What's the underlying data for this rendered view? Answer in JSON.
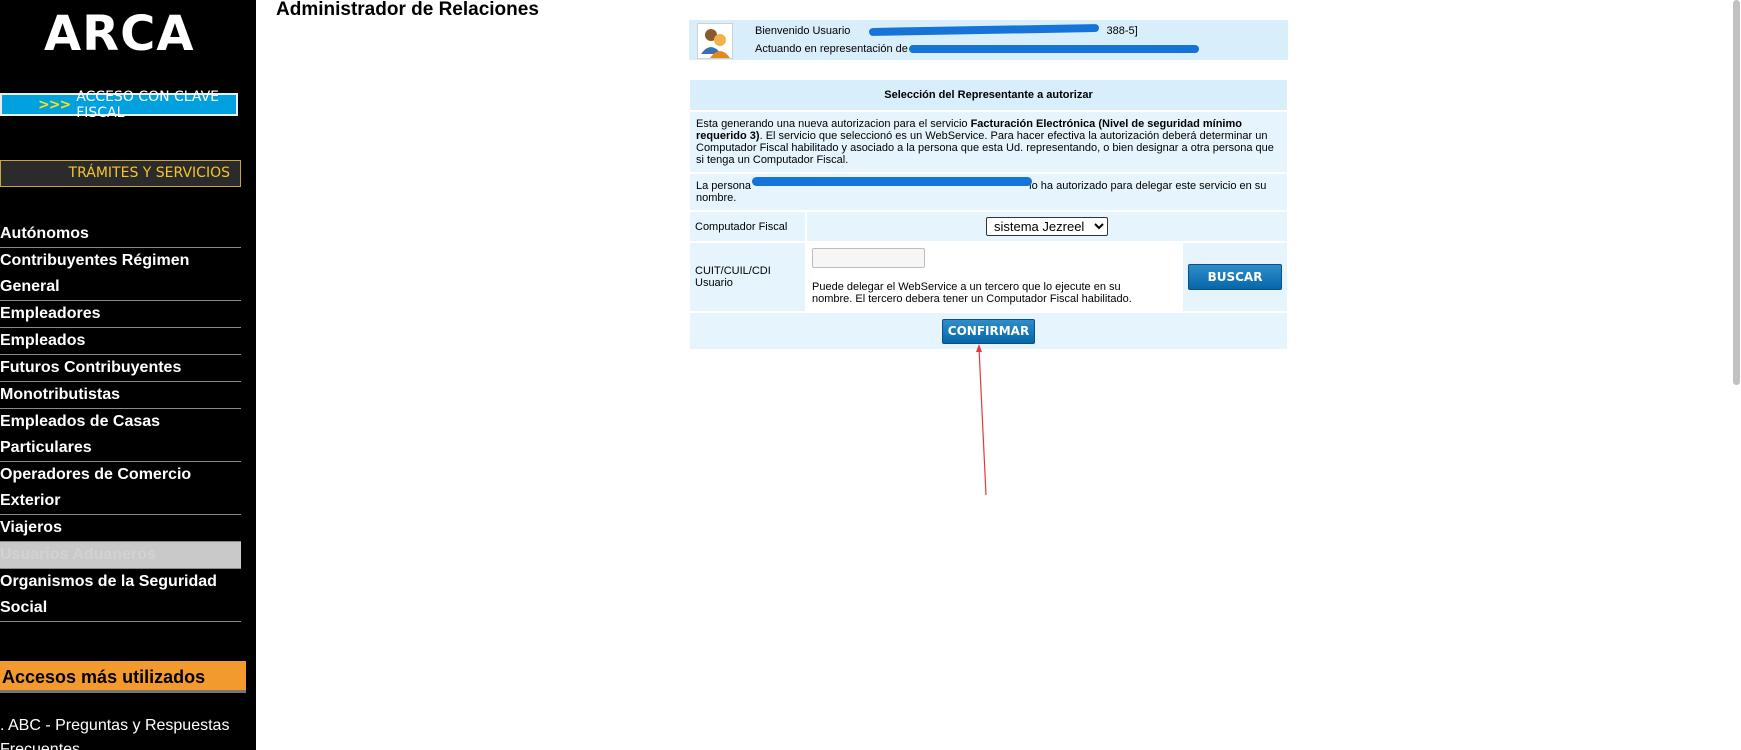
{
  "sidebar": {
    "logo": "ARCA",
    "clave_arrows": ">>>",
    "clave_label": "ACCESO CON CLAVE FISCAL",
    "tramites_label": "TRÁMITES Y SERVICIOS",
    "menu": [
      "Autónomos",
      "Contribuyentes Régimen General",
      "Empleadores",
      "Empleados",
      "Futuros Contribuyentes",
      "Monotributistas",
      "Empleados de Casas Particulares",
      "Operadores de Comercio Exterior",
      "Viajeros",
      "Usuarios Aduaneros",
      "Organismos de la Seguridad Social"
    ],
    "accesos_title": "Accesos más utilizados",
    "accesos_link": ". ABC - Preguntas y Respuestas Frecuentes"
  },
  "main": {
    "title": "Administrador de Relaciones",
    "welcome": {
      "line1_prefix": "Bienvenido Usuario",
      "line1_suffix": "388-5]",
      "line2_prefix": "Actuando en representación de"
    },
    "panel": {
      "header": "Selección del Representante a autorizar",
      "info_intro": "Esta generando una nueva autorizacion para el servicio ",
      "info_service": "Facturación Electrónica (Nivel de seguridad mínimo requerido 3)",
      "info_rest": ". El servicio que seleccionó es un WebService. Para hacer efectiva la autorización deberá determinar un Computador Fiscal habilitado y asociado a la persona que esta Ud. representando, o bien designar a otra persona que si tenga un Computador Fiscal.",
      "persona_prefix": "La persona",
      "persona_suffix": "lo ha autorizado para delegar este servicio en su nombre.",
      "computador_label": "Computador Fiscal",
      "computador_value": "sistema Jezreel",
      "cuit_label": "CUIT/CUIL/CDI Usuario",
      "cuit_placeholder": "",
      "delegate_help": "Puede delegar el WebService a un tercero que lo ejecute en su nombre. El tercero debera tener un Computador Fiscal habilitado.",
      "search_button": "BUSCAR",
      "confirm_button": "CONFIRMAR"
    }
  },
  "colors": {
    "sidebar_bg": "#000000",
    "clave_btn": "#00a1de",
    "tramites_text": "#f7c42a",
    "accesos_bg": "#f39a2e",
    "panel_light": "#e5f4fd",
    "panel_header": "#d9eefb",
    "redaction": "#1673d7",
    "annotation_arrow": "#e53935"
  },
  "icons": {
    "avatar": "users-icon"
  }
}
